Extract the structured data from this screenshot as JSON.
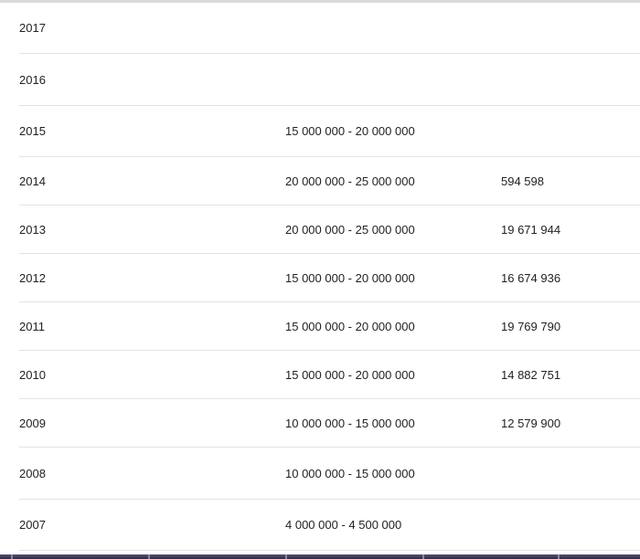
{
  "rows": [
    {
      "year": "2017",
      "range": "",
      "value": ""
    },
    {
      "year": "2016",
      "range": "",
      "value": ""
    },
    {
      "year": "2015",
      "range": "15 000 000 - 20 000 000",
      "value": ""
    },
    {
      "year": "2014",
      "range": "20 000 000 - 25 000 000",
      "value": "594 598"
    },
    {
      "year": "2013",
      "range": "20 000 000 - 25 000 000",
      "value": "19 671 944"
    },
    {
      "year": "2012",
      "range": "15 000 000 - 20 000 000",
      "value": "16 674 936"
    },
    {
      "year": "2011",
      "range": "15 000 000 - 20 000 000",
      "value": "19 769 790"
    },
    {
      "year": "2010",
      "range": "15 000 000 - 20 000 000",
      "value": "14 882 751"
    },
    {
      "year": "2009",
      "range": "10 000 000 - 15 000 000",
      "value": "12 579 900"
    },
    {
      "year": "2008",
      "range": "10 000 000 - 15 000 000",
      "value": ""
    },
    {
      "year": "2007",
      "range": "4 000 000 - 4 500 000",
      "value": ""
    }
  ],
  "colors": {
    "text": "#222222",
    "divider": "#e3e3e3",
    "taskbar": "#3a3350"
  }
}
